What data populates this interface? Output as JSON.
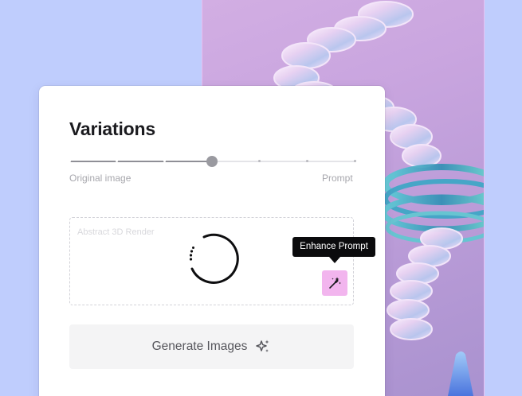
{
  "card": {
    "title": "Variations",
    "slider": {
      "left_label": "Original image",
      "right_label": "Prompt",
      "steps": 7,
      "selected_step": 3
    },
    "prompt": {
      "placeholder": "Abstract 3D Render",
      "status": "loading"
    },
    "enhance": {
      "tooltip": "Enhance Prompt",
      "icon": "magic-wand-icon"
    },
    "generate": {
      "label": "Generate Images",
      "icon": "sparkles-icon"
    }
  },
  "colors": {
    "page_background": "#bfcdfd",
    "image_background": "#c9a5df",
    "enhance_button": "#f2b5ee",
    "tooltip_background": "#0b0b0d",
    "slider_active": "#8f8f96",
    "slider_inactive": "#e4e4e8"
  }
}
